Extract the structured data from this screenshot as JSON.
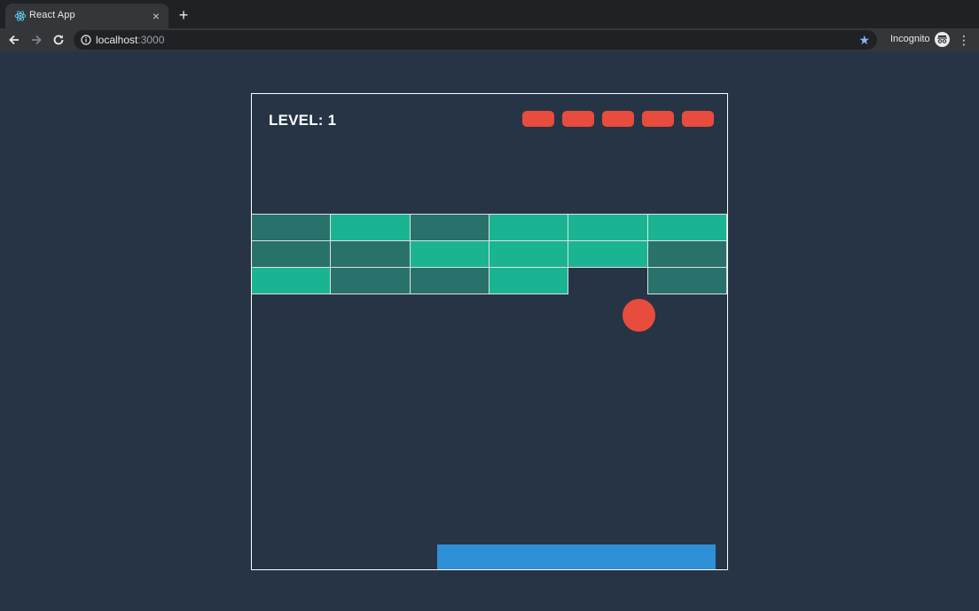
{
  "browser": {
    "tab_title": "React App",
    "tab_close": "×",
    "new_tab": "+",
    "url_host": "localhost",
    "url_port": ":3000",
    "incognito_label": "Incognito"
  },
  "game": {
    "level_label": "LEVEL: 1",
    "lives": 5,
    "colors": {
      "background": "#263445",
      "brick_light": "#1bb493",
      "brick_dark": "#29716b",
      "ball": "#e74c3c",
      "life": "#e74c3c",
      "paddle": "#2d8fd5"
    },
    "brick_grid": {
      "columns": 6,
      "rows": [
        [
          "dark",
          "light",
          "dark",
          "light",
          "light",
          "light"
        ],
        [
          "dark",
          "dark",
          "light",
          "light",
          "light",
          "dark"
        ],
        [
          "light",
          "dark",
          "dark",
          "light",
          null,
          "dark"
        ]
      ]
    }
  }
}
